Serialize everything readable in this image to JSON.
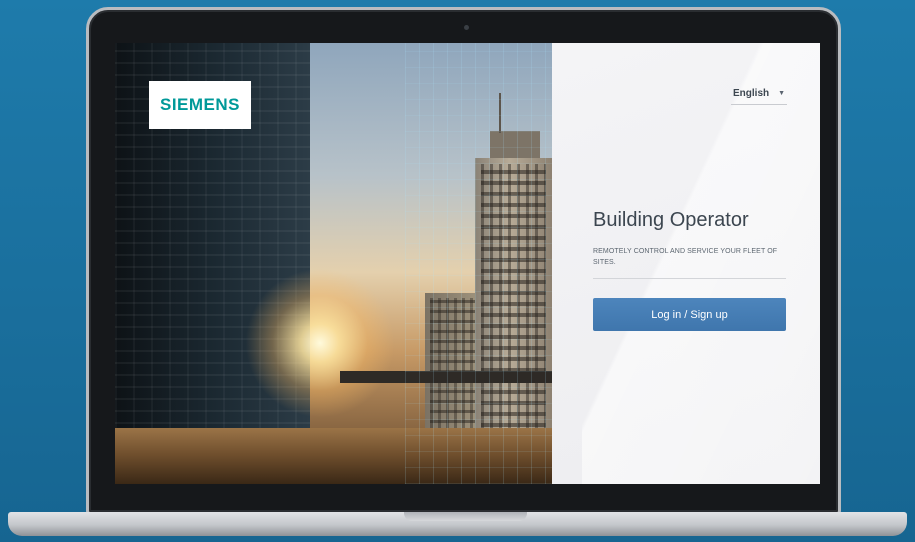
{
  "brand": {
    "logo_text": "SIEMENS",
    "logo_color": "#009999"
  },
  "language": {
    "selected": "English",
    "caret_icon": "caret-down-icon"
  },
  "app": {
    "title": "Building Operator",
    "subtitle": "REMOTELY CONTROL AND SERVICE YOUR FLEET OF SITES."
  },
  "actions": {
    "login_label": "Log in / Sign up",
    "login_color": "#4680b6"
  },
  "background_color": "#1e7bab"
}
